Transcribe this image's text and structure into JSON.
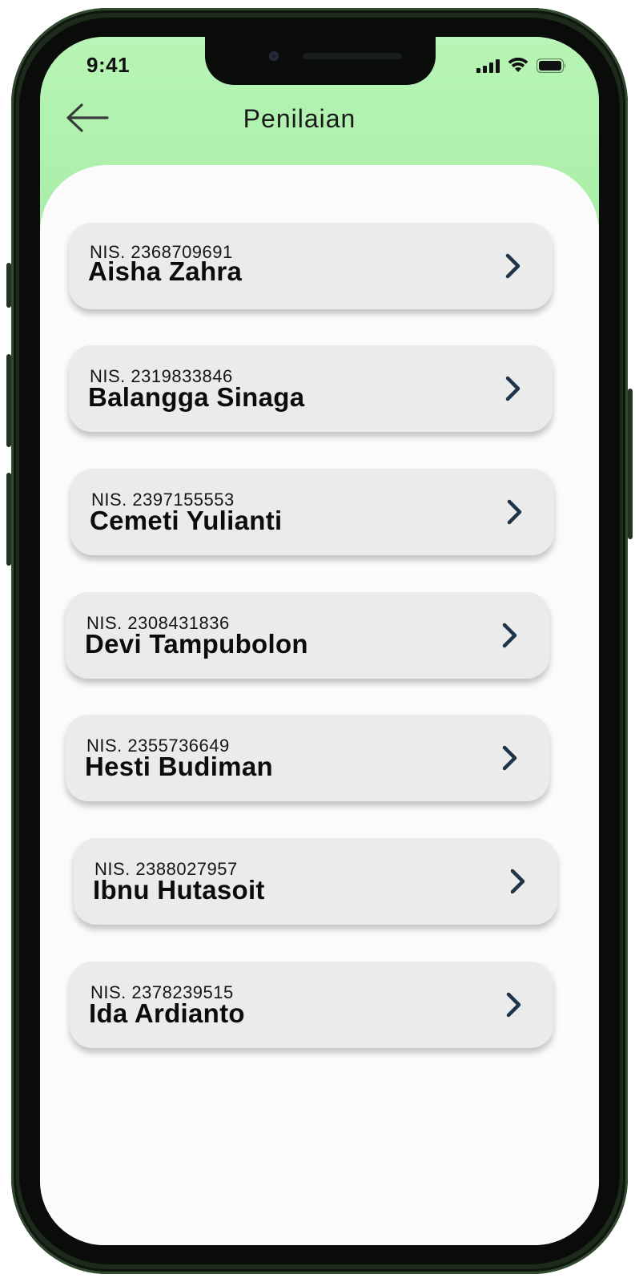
{
  "status_bar": {
    "time": "9:41"
  },
  "header": {
    "title": "Penilaian",
    "back_icon": "arrow-left-icon"
  },
  "colors": {
    "header_green": "#b8f5b6",
    "card_bg": "#ebebeb",
    "chevron": "#1e3448",
    "phone_frame": "#1d2a1c"
  },
  "students": [
    {
      "nis": "NIS. 2368709691",
      "name": "Aisha Zahra"
    },
    {
      "nis": "NIS. 2319833846",
      "name": "Balangga Sinaga"
    },
    {
      "nis": "NIS. 2397155553",
      "name": "Cemeti Yulianti"
    },
    {
      "nis": "NIS. 2308431836",
      "name": "Devi Tampubolon"
    },
    {
      "nis": "NIS. 2355736649",
      "name": "Hesti Budiman"
    },
    {
      "nis": "NIS. 2388027957",
      "name": "Ibnu Hutasoit"
    },
    {
      "nis": "NIS. 2378239515",
      "name": "Ida Ardianto"
    }
  ]
}
